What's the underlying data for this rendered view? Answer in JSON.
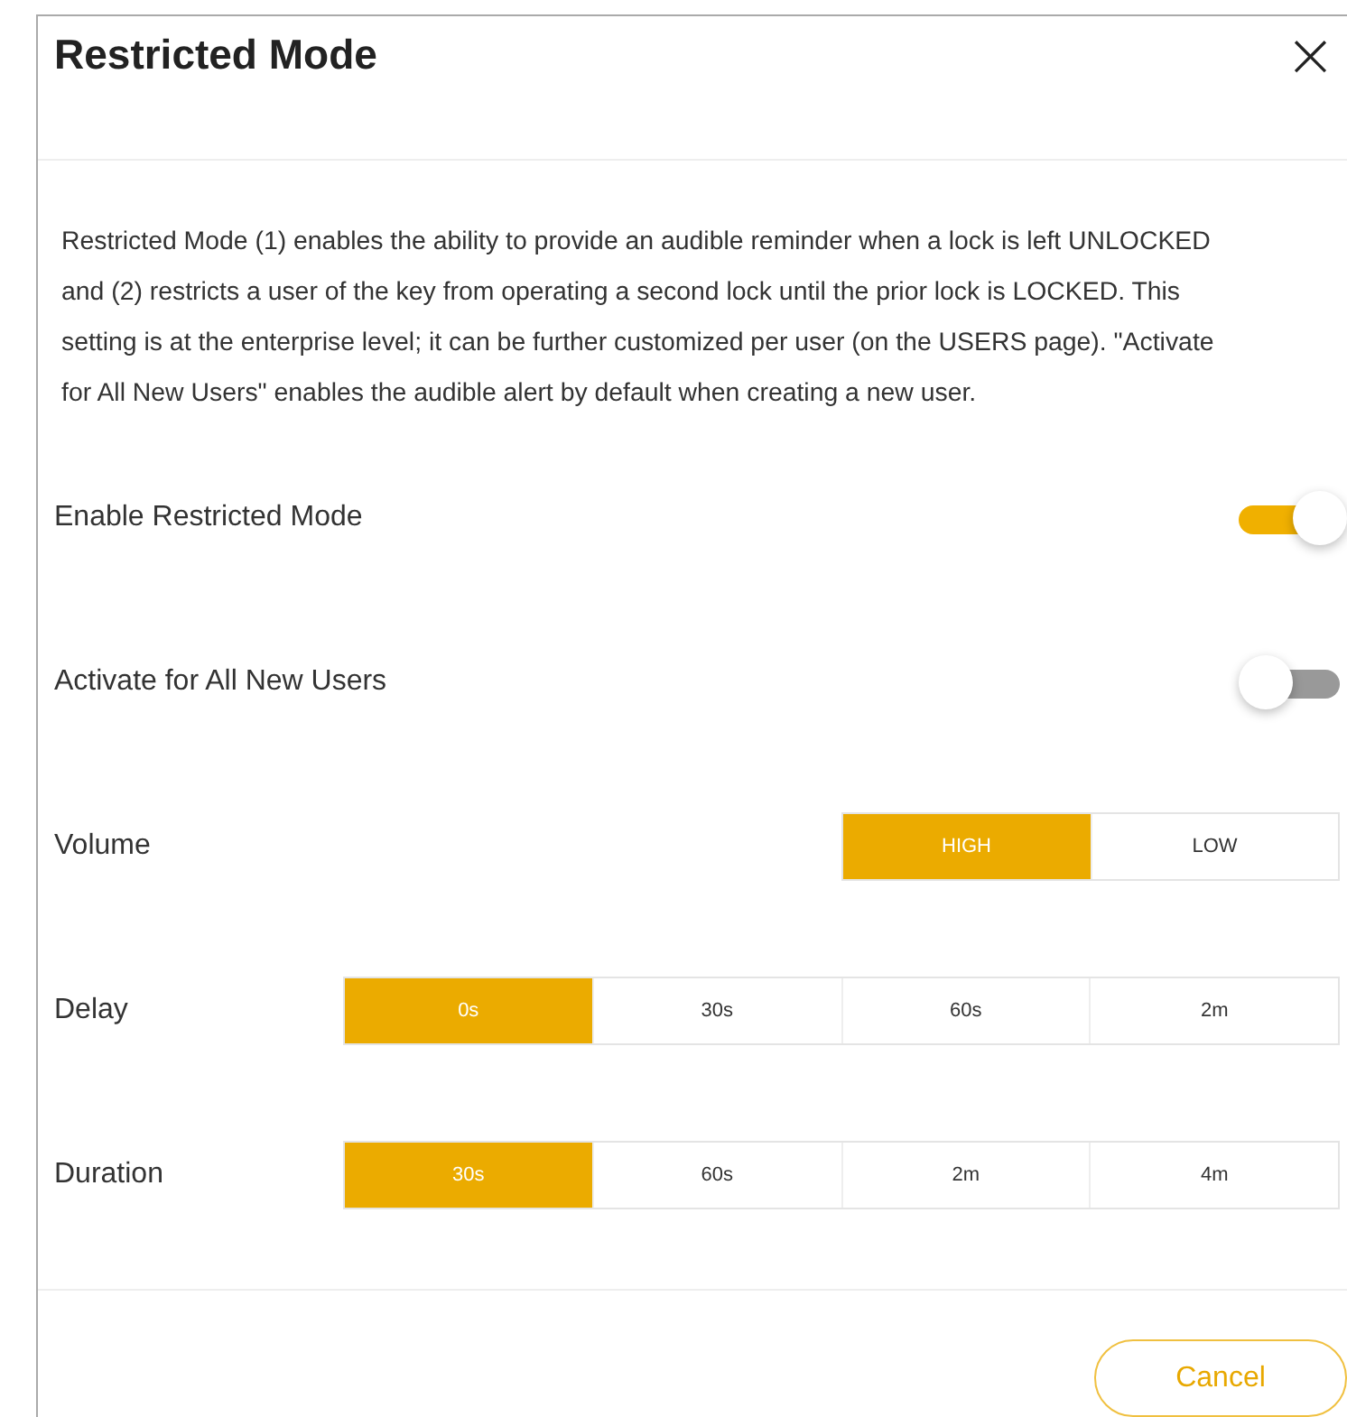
{
  "dialog": {
    "title": "Restricted Mode",
    "close": "×"
  },
  "description": "Restricted Mode (1) enables the ability to provide an audible reminder when a lock is left UNLOCKED and (2) restricts a user of the key from operating a second lock until the prior lock is LOCKED. This setting is at the enterprise level; it can be further customized per user (on the USERS page). \"Activate for All New Users\" enables the audible alert by default when creating a new user.",
  "settings": [
    {
      "kind": "toggle",
      "label": "Enable Restricted Mode",
      "on": true
    },
    {
      "kind": "toggle",
      "label": "Activate for All New Users",
      "on": false
    },
    {
      "kind": "segmented",
      "label": "Volume",
      "options": [
        {
          "label": "HIGH",
          "selected": true
        },
        {
          "label": "LOW",
          "selected": false
        }
      ]
    },
    {
      "kind": "segmented",
      "label": "Delay",
      "options": [
        {
          "label": "0s",
          "selected": true
        },
        {
          "label": "30s",
          "selected": false
        },
        {
          "label": "60s",
          "selected": false
        },
        {
          "label": "2m",
          "selected": false
        }
      ]
    },
    {
      "kind": "segmented",
      "label": "Duration",
      "options": [
        {
          "label": "30s",
          "selected": true
        },
        {
          "label": "60s",
          "selected": false
        },
        {
          "label": "2m",
          "selected": false
        },
        {
          "label": "4m",
          "selected": false
        }
      ]
    }
  ],
  "buttons": [
    "Cancel"
  ]
}
